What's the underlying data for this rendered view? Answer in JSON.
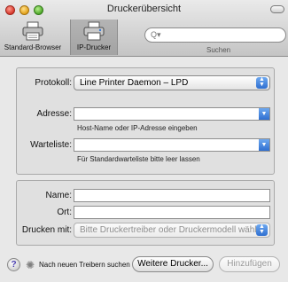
{
  "window": {
    "title": "Druckerübersicht"
  },
  "toolbar": {
    "items": [
      {
        "label": "Standard-Browser",
        "icon": "printer-icon"
      },
      {
        "label": "IP-Drucker",
        "icon": "printer-network-icon",
        "selected": true
      }
    ],
    "search": {
      "value": "",
      "label": "Suchen",
      "icon": "magnifier-icon"
    }
  },
  "connection": {
    "protocol_label": "Protokoll:",
    "protocol_value": "Line Printer Daemon – LPD",
    "address_label": "Adresse:",
    "address_value": "",
    "address_hint": "Host-Name oder IP-Adresse eingeben",
    "queue_label": "Warteliste:",
    "queue_value": "",
    "queue_hint": "Für Standardwarteliste bitte leer lassen"
  },
  "printer": {
    "name_label": "Name:",
    "name_value": "",
    "location_label": "Ort:",
    "location_value": "",
    "driver_label": "Drucken mit:",
    "driver_value": "Bitte Druckertreiber oder Druckermodell wählen"
  },
  "footer": {
    "help_label": "?",
    "status_text": "Nach neuen Treibern suchen",
    "more_printers_label": "Weitere Drucker...",
    "add_label": "Hinzufügen"
  },
  "colors": {
    "accent": "#2f6fd0",
    "background": "#e8e8e8"
  }
}
